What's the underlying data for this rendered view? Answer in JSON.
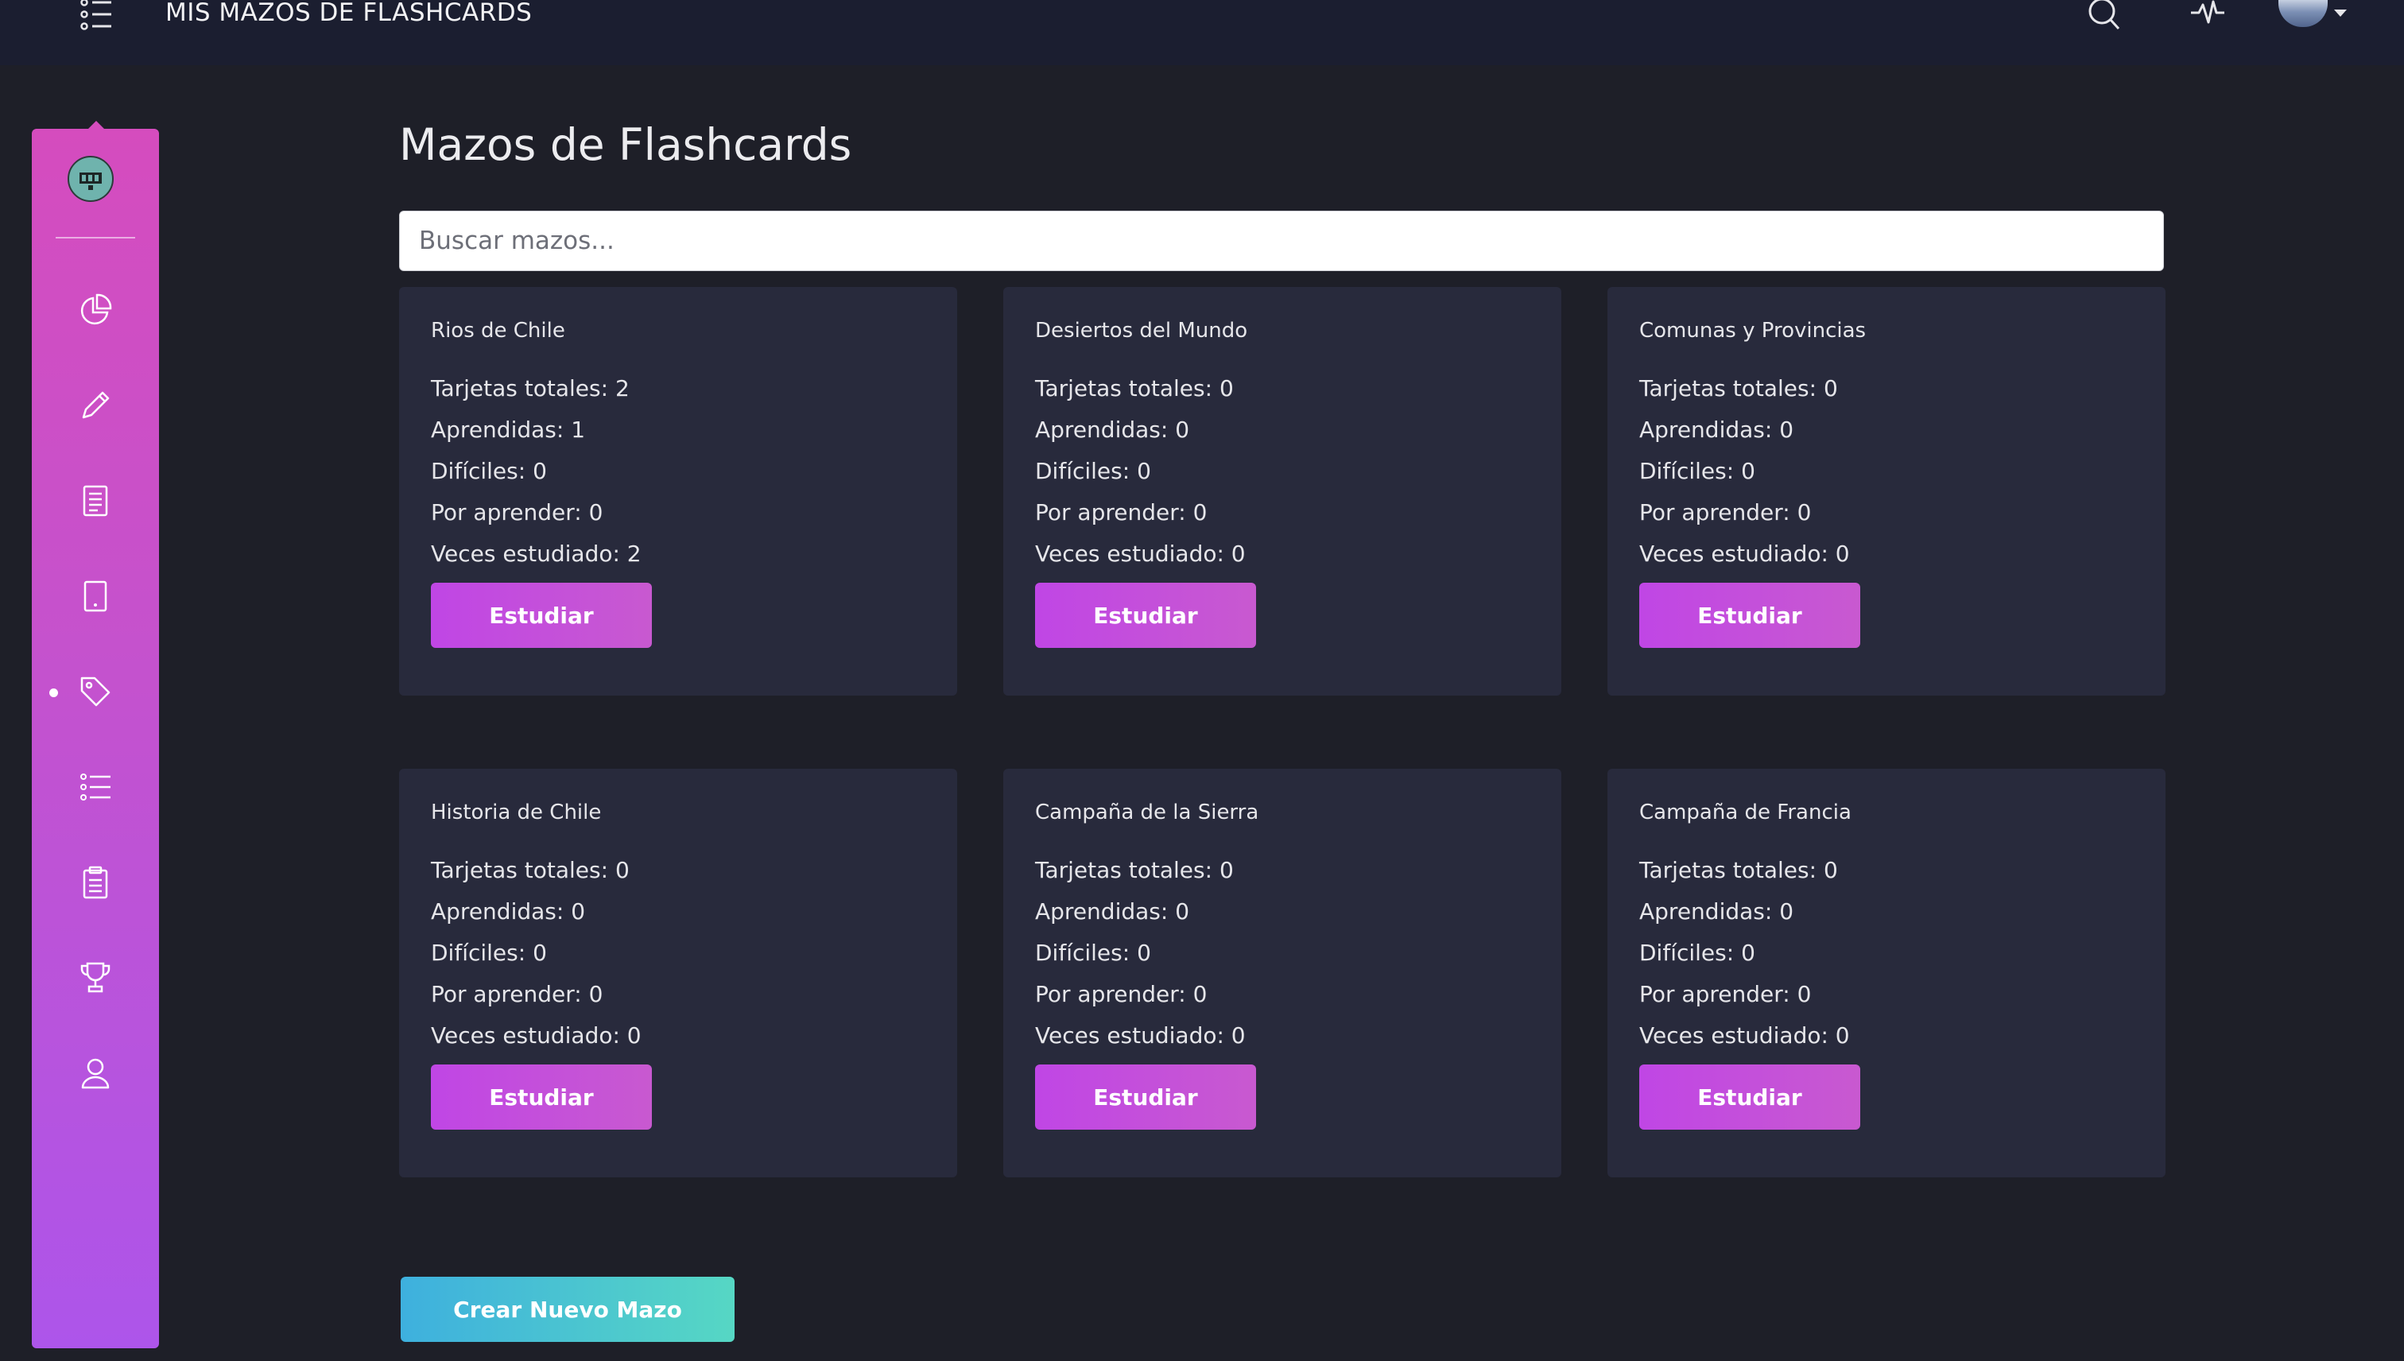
{
  "topbar": {
    "title": "MIS MAZOS DE FLASHCARDS",
    "icons": [
      "list-menu-icon",
      "search-icon",
      "activity-pulse-icon",
      "user-avatar",
      "caret-down-icon"
    ]
  },
  "sidebar": {
    "items": [
      {
        "icon": "pie-chart-icon",
        "active": false
      },
      {
        "icon": "pencil-icon",
        "active": false
      },
      {
        "icon": "document-icon",
        "active": false
      },
      {
        "icon": "tablet-icon",
        "active": false
      },
      {
        "icon": "tag-icon",
        "active": true
      },
      {
        "icon": "list-icon",
        "active": false
      },
      {
        "icon": "clipboard-icon",
        "active": false
      },
      {
        "icon": "trophy-icon",
        "active": false
      },
      {
        "icon": "user-icon",
        "active": false
      }
    ]
  },
  "main": {
    "title": "Mazos de Flashcards",
    "search_placeholder": "Buscar mazos...",
    "study_label": "Estudiar",
    "create_label": "Crear Nuevo Mazo",
    "decks": [
      {
        "name": "Rios de Chile",
        "total": "Tarjetas totales: 2",
        "learned": "Aprendidas: 1",
        "hard": "Difíciles: 0",
        "to_learn": "Por aprender: 0",
        "studied": "Veces estudiado: 2"
      },
      {
        "name": "Desiertos del Mundo",
        "total": "Tarjetas totales: 0",
        "learned": "Aprendidas: 0",
        "hard": "Difíciles: 0",
        "to_learn": "Por aprender: 0",
        "studied": "Veces estudiado: 0"
      },
      {
        "name": "Comunas y Provincias",
        "total": "Tarjetas totales: 0",
        "learned": "Aprendidas: 0",
        "hard": "Difíciles: 0",
        "to_learn": "Por aprender: 0",
        "studied": "Veces estudiado: 0"
      },
      {
        "name": "Historia de Chile",
        "total": "Tarjetas totales: 0",
        "learned": "Aprendidas: 0",
        "hard": "Difíciles: 0",
        "to_learn": "Por aprender: 0",
        "studied": "Veces estudiado: 0"
      },
      {
        "name": "Campaña de la Sierra",
        "total": "Tarjetas totales: 0",
        "learned": "Aprendidas: 0",
        "hard": "Difíciles: 0",
        "to_learn": "Por aprender: 0",
        "studied": "Veces estudiado: 0"
      },
      {
        "name": "Campaña de Francia",
        "total": "Tarjetas totales: 0",
        "learned": "Aprendidas: 0",
        "hard": "Difíciles: 0",
        "to_learn": "Por aprender: 0",
        "studied": "Veces estudiado: 0"
      }
    ]
  },
  "colors": {
    "background": "#1e1f28",
    "topbar": "#1b1e30",
    "card": "#282a3c",
    "sidebar_gradient": [
      "#d54cbe",
      "#ad55ea"
    ],
    "study_button": "#c046e5",
    "create_button_gradient": [
      "#3eb0de",
      "#56d7c4"
    ]
  }
}
